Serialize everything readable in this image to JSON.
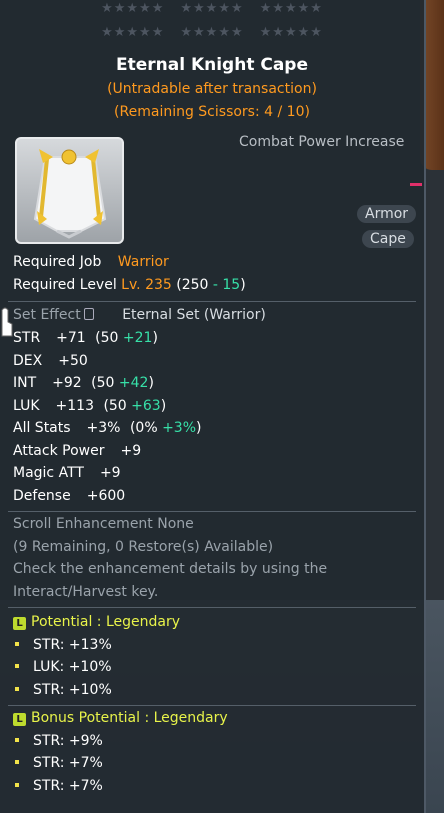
{
  "item": {
    "stars_rows": 2,
    "name": "Eternal Knight Cape",
    "trade_note": "(Untradable after transaction)",
    "scissors": "(Remaining Scissors: 4 / 10)",
    "combat_power_label": "Combat Power Increase",
    "tags": [
      "Armor",
      "Cape"
    ]
  },
  "requirements": {
    "job_label": "Required Job",
    "job_value": "Warrior",
    "level_label": "Required Level",
    "level_value": "Lv. 235",
    "level_detail_open": "(250",
    "level_detail_mod": "- 15",
    "level_detail_close": ")"
  },
  "set_effect": {
    "label": "Set Effect",
    "name": "Eternal Set (Warrior)"
  },
  "stats": [
    {
      "name": "STR",
      "total": "+71",
      "base": "(50",
      "bonus": "+21",
      "close": ")"
    },
    {
      "name": "DEX",
      "total": "+50"
    },
    {
      "name": "INT",
      "total": "+92",
      "base": "(50",
      "bonus": "+42",
      "close": ")"
    },
    {
      "name": "LUK",
      "total": "+113",
      "base": "(50",
      "bonus": "+63",
      "close": ")"
    },
    {
      "name": "All Stats",
      "total": "+3%",
      "base": "(0%",
      "bonus": "+3%",
      "close": ")"
    },
    {
      "name": "Attack Power",
      "total": "+9"
    },
    {
      "name": "Magic ATT",
      "total": "+9"
    },
    {
      "name": "Defense",
      "total": "+600"
    }
  ],
  "scroll": {
    "line1": "Scroll Enhancement None",
    "line2": "(9 Remaining, 0 Restore(s) Available)",
    "line3": "Check the enhancement details by using the",
    "line4": "Interact/Harvest key."
  },
  "potential": {
    "badge": "L",
    "label": "Potential : Legendary",
    "lines": [
      "STR: +13%",
      "LUK: +10%",
      "STR: +10%"
    ]
  },
  "bonus_potential": {
    "badge": "L",
    "label": "Bonus Potential : Legendary",
    "lines": [
      "STR: +9%",
      "STR: +7%",
      "STR: +7%"
    ]
  },
  "colors": {
    "orange": "#ff9a1f",
    "green": "#37e0a8",
    "potential": "#e8f34a"
  }
}
